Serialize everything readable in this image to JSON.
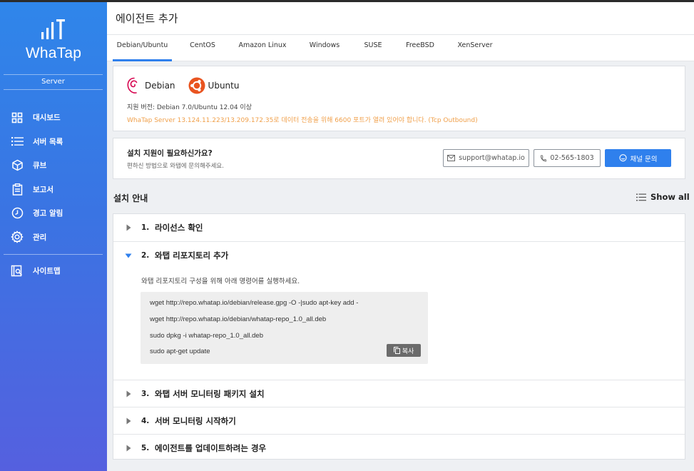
{
  "app": {
    "logo_text": "WhaTap",
    "section": "Server"
  },
  "sidebar": {
    "items": [
      {
        "label": "대시보드",
        "icon": "dashboard-grid-icon"
      },
      {
        "label": "서버 목록",
        "icon": "list-icon"
      },
      {
        "label": "큐브",
        "icon": "cube-icon"
      },
      {
        "label": "보고서",
        "icon": "report-clipboard-icon"
      },
      {
        "label": "경고 알림",
        "icon": "clock-alert-icon"
      },
      {
        "label": "관리",
        "icon": "gear-icon"
      }
    ],
    "sitemap": {
      "label": "사이트맵",
      "icon": "sitemap-icon"
    }
  },
  "header": {
    "title": "에이전트 추가"
  },
  "tabs": [
    "Debian/Ubuntu",
    "CentOS",
    "Amazon Linux",
    "Windows",
    "SUSE",
    "FreeBSD",
    "XenServer"
  ],
  "os_card": {
    "os": [
      {
        "name": "Debian",
        "icon": "debian-logo"
      },
      {
        "name": "Ubuntu",
        "icon": "ubuntu-logo"
      }
    ],
    "support_version": "지원 버전: Debian 7.0/Ubuntu 12.04 이상",
    "network_note": "WhaTap Server 13.124.11.223/13.209.172.35로 데이터 전송을 위해 6600 포트가 열려 있어야 합니다. (Tcp Outbound)"
  },
  "help_card": {
    "title": "설치 지원이 필요하신가요?",
    "subtitle": "편하신 방법으로 와탭에 문의해주세요.",
    "email": "support@whatap.io",
    "phone": "02-565-1803",
    "chat": "채널 문의"
  },
  "guide": {
    "title": "설치 안내",
    "show_all": "Show all",
    "steps": [
      {
        "num": "1.",
        "title": "라이선스 확인",
        "expanded": false
      },
      {
        "num": "2.",
        "title": "와탭 리포지토리 추가",
        "expanded": true
      },
      {
        "num": "3.",
        "title": "와탭 서버 모니터링 패키지 설치",
        "expanded": false
      },
      {
        "num": "4.",
        "title": "서버 모니터링 시작하기",
        "expanded": false
      },
      {
        "num": "5.",
        "title": "에이전트를 업데이트하려는 경우",
        "expanded": false
      }
    ],
    "step2_desc": "와탭 리포지토리 구성을 위해 아래 명령어를 실행하세요.",
    "step2_code": [
      "wget http://repo.whatap.io/debian/release.gpg -O -|sudo apt-key add -",
      "wget http://repo.whatap.io/debian/whatap-repo_1.0_all.deb",
      "sudo dpkg -i whatap-repo_1.0_all.deb",
      "sudo apt-get update"
    ],
    "copy_label": "복사"
  },
  "colors": {
    "accent": "#2f80ed",
    "note": "#f0a04b",
    "sidebar_top": "#2f86ea",
    "sidebar_bottom": "#5560df"
  }
}
